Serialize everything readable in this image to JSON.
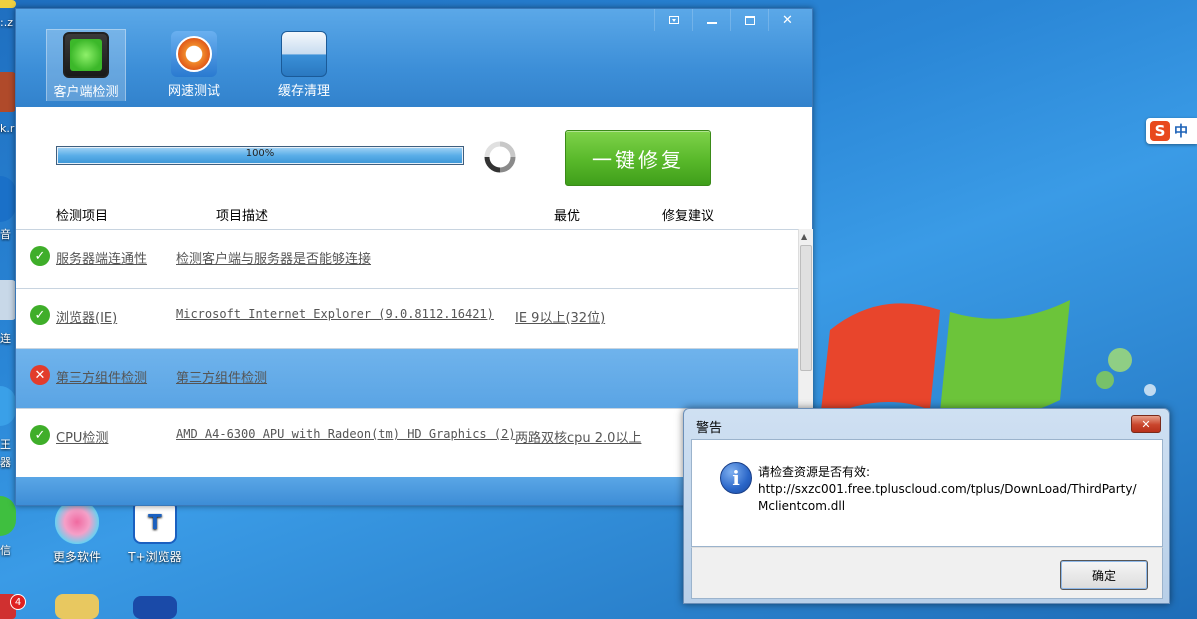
{
  "app": {
    "tools": [
      {
        "label": "客户端检测",
        "icon": "monitor-icon"
      },
      {
        "label": "网速测试",
        "icon": "speedometer-icon"
      },
      {
        "label": "缓存清理",
        "icon": "toolbox-icon"
      }
    ],
    "progress": {
      "text": "100%",
      "value": 100
    },
    "fix_button": "一键修复",
    "columns": [
      "检测项目",
      "项目描述",
      "最优",
      "修复建议"
    ],
    "rows": [
      {
        "status": "ok",
        "name": "服务器端连通性",
        "desc": "检测客户端与服务器是否能够连接",
        "best": ""
      },
      {
        "status": "ok",
        "name": "浏览器(IE)",
        "desc": "Microsoft Internet Explorer (9.0.8112.16421)",
        "best": "IE 9以上(32位)"
      },
      {
        "status": "error",
        "name": "第三方组件检测",
        "desc": "第三方组件检测",
        "best": ""
      },
      {
        "status": "ok",
        "name": "CPU检测",
        "desc": "AMD A4-6300 APU with Radeon(tm) HD Graphics (2)",
        "best": "两路双核cpu 2.0以上"
      }
    ]
  },
  "dialog": {
    "title": "警告",
    "line1": "请检查资源是否有效:",
    "line2": "http://sxzc001.free.tpluscloud.com/tplus/DownLoad/ThirdParty/",
    "line3": "Mclientcom.dll",
    "ok": "确定"
  },
  "desktop": {
    "icons": [
      {
        "label": "更多软件"
      },
      {
        "label": "T+浏览器"
      }
    ],
    "left_labels": [
      ":.z",
      "k.r",
      "音",
      "连",
      "王",
      "器",
      "信"
    ],
    "badge_count": "4",
    "ime": {
      "char": "中"
    }
  }
}
